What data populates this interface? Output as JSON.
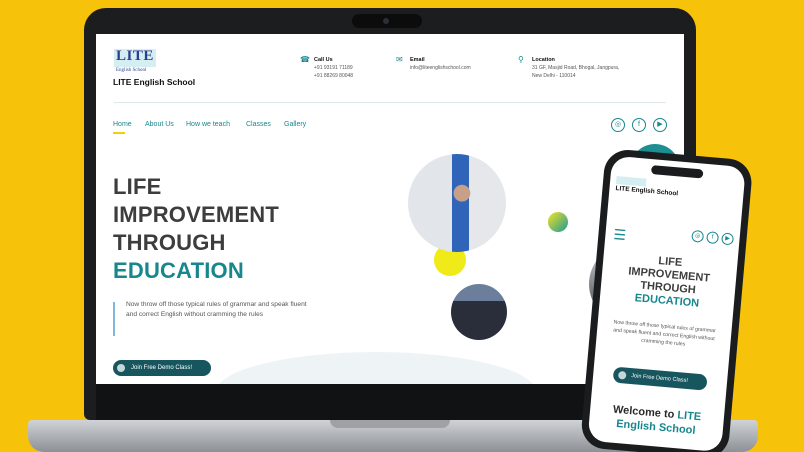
{
  "header": {
    "logo_text": "LITE",
    "logo_sub": "English School",
    "school_name": "LITE English School",
    "contacts": [
      {
        "icon": "phone-icon",
        "title": "Call Us",
        "lines": [
          "+91 93191 71189",
          "+91 88269 80048"
        ]
      },
      {
        "icon": "email-icon",
        "title": "Email",
        "lines": [
          "info@liteenglishschool.com",
          ""
        ]
      },
      {
        "icon": "location-icon",
        "title": "Location",
        "lines": [
          "31 GF, Masjid Road, Bhogal, Jangpura,",
          "New Delhi - 110014"
        ]
      }
    ]
  },
  "nav": {
    "items": [
      "Home",
      "About Us",
      "How we teach",
      "Classes",
      "Gallery"
    ],
    "social": [
      "instagram-icon",
      "facebook-icon",
      "youtube-icon"
    ]
  },
  "hero": {
    "line1": "LIFE",
    "line2": "IMPROVEMENT",
    "line3": "THROUGH",
    "line4": "EDUCATION",
    "desc": "Now throw off those typical rules of grammar and speak fluent and correct English without cramming the rules",
    "cta": "Join Free Demo Class!"
  },
  "mobile": {
    "school_name": "LITE English School",
    "hero_line1": "LIFE",
    "hero_line2": "IMPROVEMENT",
    "hero_line3": "THROUGH",
    "hero_line4": "EDUCATION",
    "desc": "Now throw off those typical rules of grammar and speak fluent and correct English without cramming the rules",
    "cta": "Join Free Demo Class!",
    "welcome_prefix": "Welcome to ",
    "welcome_lite": "LITE",
    "welcome_suffix": "English School"
  },
  "colors": {
    "accent": "#17878e",
    "background": "#f7c20a",
    "button": "#17565e",
    "highlight": "#f4cd0c"
  }
}
